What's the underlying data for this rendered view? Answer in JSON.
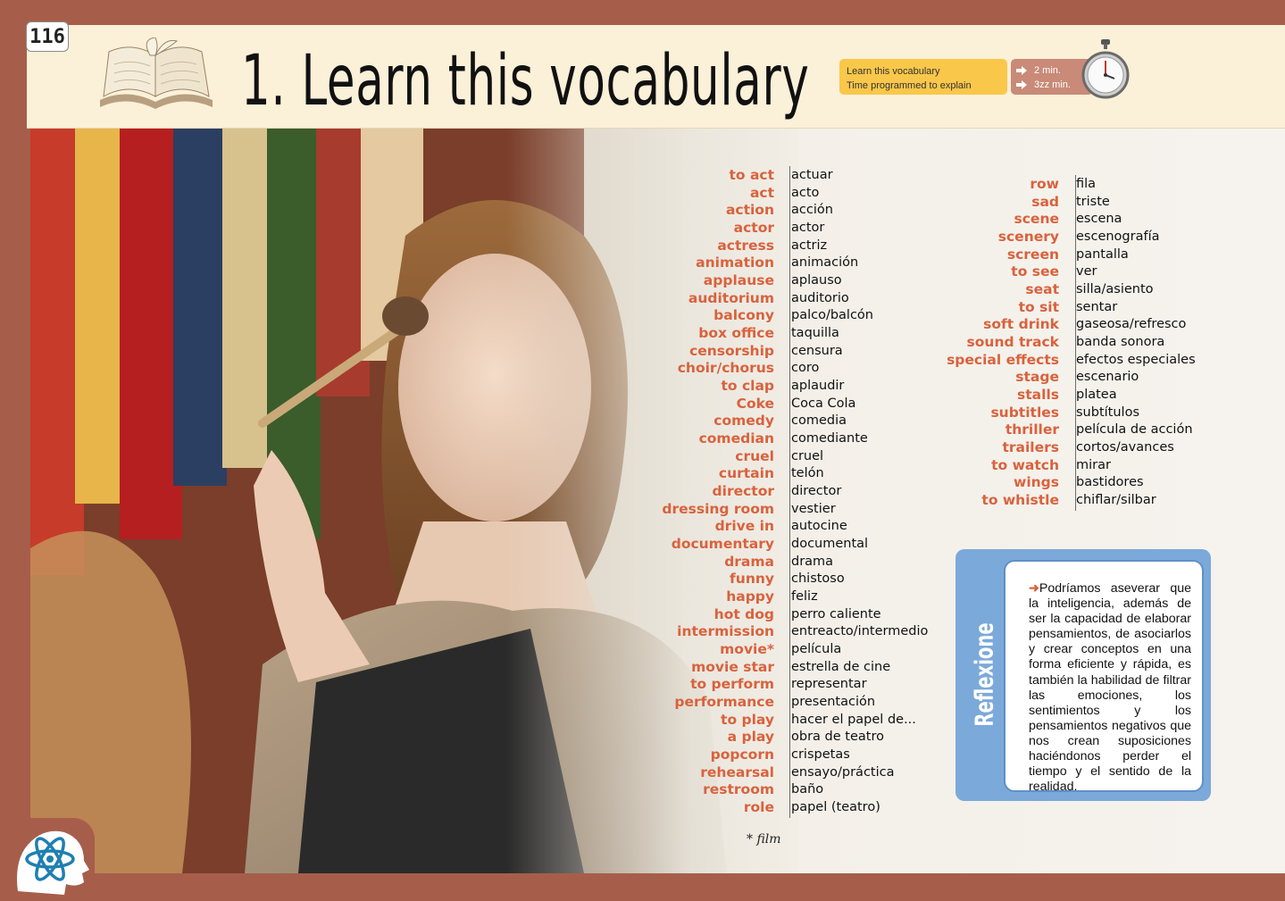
{
  "page_number": "116",
  "title": "1. Learn this vocabulary",
  "info_box": {
    "line1": "Learn this vocabulary",
    "line2": "Time programmed to explain"
  },
  "time_box": {
    "time1": "2 min.",
    "time2": "3zz min."
  },
  "icons": {
    "book": "open-book-icon",
    "stopwatch": "stopwatch-icon",
    "arrow": "arrow-right-icon",
    "logo": "head-atom-icon"
  },
  "colors": {
    "frame": "#a65e4b",
    "header": "#fbf0d8",
    "english_term": "#d9623d",
    "info_box": "#f9c74a",
    "time_box": "#c98a78",
    "reflex_box": "#7ba9da"
  },
  "vocab_col1": [
    {
      "en": "to act",
      "es": "actuar"
    },
    {
      "en": "act",
      "es": "acto"
    },
    {
      "en": "action",
      "es": "acción"
    },
    {
      "en": "actor",
      "es": "actor"
    },
    {
      "en": "actress",
      "es": "actriz"
    },
    {
      "en": "animation",
      "es": "animación"
    },
    {
      "en": "applause",
      "es": "aplauso"
    },
    {
      "en": "auditorium",
      "es": "auditorio"
    },
    {
      "en": "balcony",
      "es": "palco/balcón"
    },
    {
      "en": "box office",
      "es": "taquilla"
    },
    {
      "en": "censorship",
      "es": "censura"
    },
    {
      "en": "choir/chorus",
      "es": "coro"
    },
    {
      "en": "to clap",
      "es": "aplaudir"
    },
    {
      "en": "Coke",
      "es": "Coca Cola"
    },
    {
      "en": "comedy",
      "es": "comedia"
    },
    {
      "en": "comedian",
      "es": "comediante"
    },
    {
      "en": "cruel",
      "es": "cruel"
    },
    {
      "en": "curtain",
      "es": "telón"
    },
    {
      "en": "director",
      "es": "director"
    },
    {
      "en": "dressing room",
      "es": "vestier"
    },
    {
      "en": "drive in",
      "es": "autocine"
    },
    {
      "en": "documentary",
      "es": "documental"
    },
    {
      "en": "drama",
      "es": "drama"
    },
    {
      "en": "funny",
      "es": "chistoso"
    },
    {
      "en": "happy",
      "es": "feliz"
    },
    {
      "en": "hot dog",
      "es": "perro caliente"
    },
    {
      "en": "intermission",
      "es": "entreacto/intermedio"
    },
    {
      "en": "movie*",
      "es": "película"
    },
    {
      "en": "movie star",
      "es": "estrella de cine"
    },
    {
      "en": "to perform",
      "es": "representar"
    },
    {
      "en": "performance",
      "es": "presentación"
    },
    {
      "en": "to play",
      "es": "hacer el papel de..."
    },
    {
      "en": "a play",
      "es": "obra de teatro"
    },
    {
      "en": "popcorn",
      "es": "crispetas"
    },
    {
      "en": "rehearsal",
      "es": "ensayo/práctica"
    },
    {
      "en": "restroom",
      "es": "baño"
    },
    {
      "en": "role",
      "es": "papel (teatro)"
    }
  ],
  "vocab_col2": [
    {
      "en": "row",
      "es": "fila"
    },
    {
      "en": "sad",
      "es": "triste"
    },
    {
      "en": "scene",
      "es": "escena"
    },
    {
      "en": "scenery",
      "es": "escenografía"
    },
    {
      "en": "screen",
      "es": "pantalla"
    },
    {
      "en": "to see",
      "es": "ver"
    },
    {
      "en": "seat",
      "es": "silla/asiento"
    },
    {
      "en": "to sit",
      "es": "sentar"
    },
    {
      "en": "soft drink",
      "es": "gaseosa/refresco"
    },
    {
      "en": "sound track",
      "es": "banda sonora"
    },
    {
      "en": "special effects",
      "es": "efectos especiales"
    },
    {
      "en": "stage",
      "es": "escenario"
    },
    {
      "en": "stalls",
      "es": "platea"
    },
    {
      "en": "subtitles",
      "es": "subtítulos"
    },
    {
      "en": "thriller",
      "es": "película de acción"
    },
    {
      "en": "trailers",
      "es": "cortos/avances"
    },
    {
      "en": "to watch",
      "es": "mirar"
    },
    {
      "en": "wings",
      "es": "bastidores"
    },
    {
      "en": "to whistle",
      "es": "chiflar/silbar"
    }
  ],
  "footnote": "* film",
  "reflexione": {
    "label": "Reflexione",
    "text": "Podríamos aseverar que la inteligencia, además de ser la capacidad de elaborar pensamientos, de asociarlos y crear conceptos en una forma eficiente y rápida, es también la habilidad de filtrar las emociones, los sentimientos y los pensamientos negativos que nos crean suposiciones haciéndonos perder el tiempo y el sentido de la realidad."
  }
}
